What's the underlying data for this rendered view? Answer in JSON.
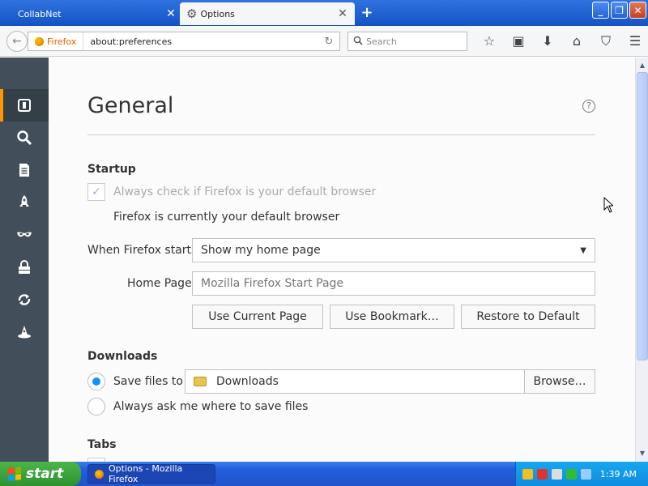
{
  "tabs": [
    {
      "label": "CollabNet",
      "active": false
    },
    {
      "label": "Options",
      "active": true
    }
  ],
  "navbar": {
    "identity": "Firefox",
    "url": "about:preferences",
    "search_placeholder": "Search"
  },
  "sidebar": {
    "selected": "general",
    "items": [
      "general-icon",
      "search-icon",
      "content-icon",
      "applications-icon",
      "privacy-icon",
      "security-icon",
      "sync-icon",
      "advanced-icon"
    ]
  },
  "page": {
    "title": "General",
    "help": "?"
  },
  "startup": {
    "heading": "Startup",
    "default_check_label": "Always check if Firefox is your default browser",
    "default_check_checked": true,
    "default_status": "Firefox is currently your default browser",
    "when_starts_label": "When Firefox starts:",
    "when_starts_value": "Show my home page",
    "home_page_label": "Home Page:",
    "home_page_placeholder": "Mozilla Firefox Start Page",
    "use_current_page": "Use Current Page",
    "use_bookmark": "Use Bookmark…",
    "restore_default": "Restore to Default"
  },
  "downloads": {
    "heading": "Downloads",
    "save_files_label": "Save files to",
    "folder": "Downloads",
    "browse": "Browse…",
    "always_ask_label": "Always ask me where to save files",
    "selected_option": "save_files"
  },
  "tabs_section": {
    "heading": "Tabs"
  },
  "taskbar": {
    "start": "start",
    "window_item": "Options - Mozilla Firefox",
    "clock": "1:39 AM"
  },
  "colors": {
    "accent": "#0996f8",
    "sidebar": "#424f5a",
    "selected_marker": "#ff9500",
    "titlebar": "#1553c4"
  }
}
